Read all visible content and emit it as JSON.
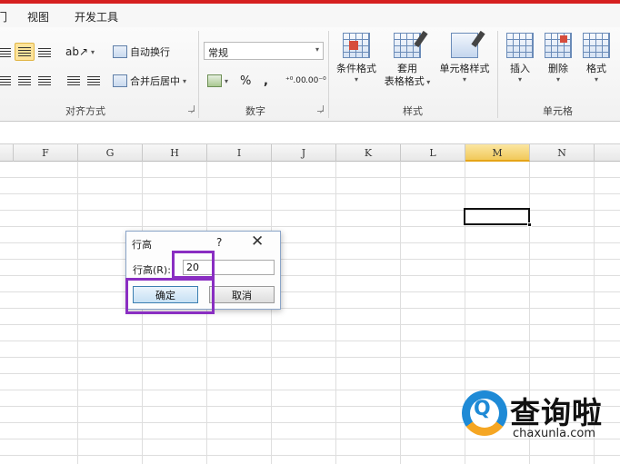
{
  "menu": {
    "items": [
      "视图",
      "开发工具"
    ],
    "partial_item": "门"
  },
  "ribbon": {
    "alignment": {
      "wrap_text": "自动换行",
      "merge_center": "合并后居中",
      "group_label": "对齐方式"
    },
    "number": {
      "format_value": "常规",
      "percent": "%",
      "comma": ",",
      "increase_decimal": "⁺⁰.00",
      "decrease_decimal": ".00⁻⁰",
      "group_label": "数字"
    },
    "styles": {
      "conditional_format": "条件格式",
      "table_format_line1": "套用",
      "table_format_line2": "表格格式",
      "cell_styles": "单元格样式",
      "group_label": "样式"
    },
    "cells": {
      "insert": "插入",
      "delete": "删除",
      "format": "格式",
      "group_label": "单元格"
    }
  },
  "sheet": {
    "columns": [
      "F",
      "G",
      "H",
      "I",
      "J",
      "K",
      "L",
      "M",
      "N"
    ],
    "active_column": "M"
  },
  "dialog": {
    "title": "行高",
    "help": "?",
    "close": "✕",
    "field_label": "行高(R):",
    "field_value": "20",
    "ok_label": "确定",
    "cancel_label": "取消"
  },
  "watermark": {
    "brand": "查询啦",
    "url": "chaxunla.com",
    "letter": "Q"
  },
  "colors": {
    "highlight": "#8a2ec2",
    "top_bar": "#d62020",
    "active_column": "#f1c95a"
  }
}
